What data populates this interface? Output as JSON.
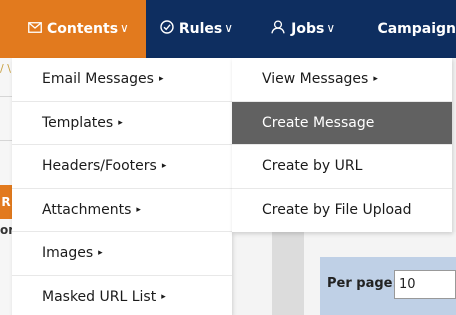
{
  "nav": {
    "items": [
      {
        "label": "Contents",
        "chevron": "∨"
      },
      {
        "label": "Rules",
        "chevron": "∨"
      },
      {
        "label": "Jobs",
        "chevron": "∨"
      },
      {
        "label": "Campaign"
      }
    ],
    "icons": {
      "contents": "envelope-icon",
      "rules": "check-circle-icon",
      "jobs": "person-icon"
    },
    "colors": {
      "bar": "#0e2e60",
      "active": "#e27a1e"
    }
  },
  "menu": {
    "items": [
      {
        "label": "Email Messages",
        "arrow": "▸"
      },
      {
        "label": "Templates",
        "arrow": "▸"
      },
      {
        "label": "Headers/Footers",
        "arrow": "▸"
      },
      {
        "label": "Attachments",
        "arrow": "▸"
      },
      {
        "label": "Images",
        "arrow": "▸"
      },
      {
        "label": "Masked URL List",
        "arrow": "▸"
      }
    ]
  },
  "submenu": {
    "items": [
      {
        "label": "View Messages",
        "arrow": "▸"
      },
      {
        "label": "Create Message"
      },
      {
        "label": "Create by URL"
      },
      {
        "label": "Create by File Upload"
      }
    ]
  },
  "background": {
    "breadcrumb_fragment": "/ \\",
    "orange_button_fragment": "R",
    "text_fragment": "or",
    "per_page_label": "Per page:",
    "per_page_value": "10"
  }
}
